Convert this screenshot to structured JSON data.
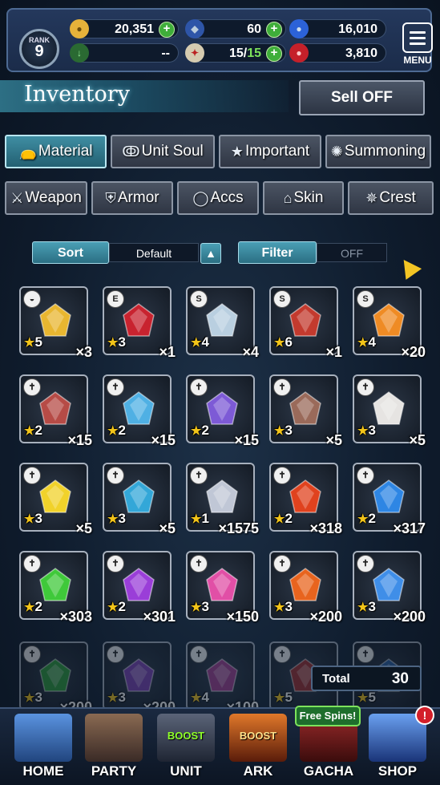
{
  "status": {
    "rank_label": "RANK",
    "rank": "9",
    "gil": "20,351",
    "visiore": "60",
    "lapis": "16,010",
    "exp_display": "--",
    "stamina": "15/",
    "stamina_max": "15",
    "ruby": "3,810",
    "menu_label": "MENU"
  },
  "header": {
    "title": "Inventory",
    "sell_label": "Sell OFF"
  },
  "tabs_row1": [
    {
      "label": "Material",
      "icon": "bag-icon",
      "active": true
    },
    {
      "label": "Unit Soul",
      "icon": "soul-icon",
      "active": false
    },
    {
      "label": "Important",
      "icon": "star-icon",
      "active": false
    },
    {
      "label": "Summoning",
      "icon": "summon-icon",
      "active": false
    }
  ],
  "tabs_row2": [
    {
      "label": "Weapon",
      "icon": "sword-icon"
    },
    {
      "label": "Armor",
      "icon": "armor-icon"
    },
    {
      "label": "Accs",
      "icon": "ring-icon"
    },
    {
      "label": "Skin",
      "icon": "hanger-icon"
    },
    {
      "label": "Crest",
      "icon": "crest-icon"
    }
  ],
  "controls": {
    "sort_label": "Sort",
    "sort_value": "Default",
    "filter_label": "Filter",
    "filter_value": "OFF"
  },
  "items": [
    {
      "stars": "5",
      "qty": "×3",
      "badge": "bag",
      "color": "#e8b630"
    },
    {
      "stars": "3",
      "qty": "×1",
      "badge": "EXP",
      "color": "#c8232f"
    },
    {
      "stars": "4",
      "qty": "×4",
      "badge": "ST",
      "color": "#b9cfe0"
    },
    {
      "stars": "6",
      "qty": "×1",
      "badge": "ST",
      "color": "#c33a2e"
    },
    {
      "stars": "4",
      "qty": "×20",
      "badge": "ST",
      "color": "#ef8b24"
    },
    {
      "stars": "2",
      "qty": "×15",
      "badge": "M",
      "color": "#b64b46"
    },
    {
      "stars": "2",
      "qty": "×15",
      "badge": "M",
      "color": "#4fb0e4"
    },
    {
      "stars": "2",
      "qty": "×15",
      "badge": "M",
      "color": "#7d5ad6"
    },
    {
      "stars": "3",
      "qty": "×5",
      "badge": "M",
      "color": "#9a6a5a"
    },
    {
      "stars": "3",
      "qty": "×5",
      "badge": "M",
      "color": "#e6e4e2"
    },
    {
      "stars": "3",
      "qty": "×5",
      "badge": "M",
      "color": "#f1d22a"
    },
    {
      "stars": "3",
      "qty": "×5",
      "badge": "M",
      "color": "#33a7d8"
    },
    {
      "stars": "1",
      "qty": "×1575",
      "badge": "M",
      "color": "#c0c7d6"
    },
    {
      "stars": "2",
      "qty": "×318",
      "badge": "M",
      "color": "#e0421e"
    },
    {
      "stars": "2",
      "qty": "×317",
      "badge": "M",
      "color": "#2e86e4"
    },
    {
      "stars": "2",
      "qty": "×303",
      "badge": "M",
      "color": "#3fc93a"
    },
    {
      "stars": "2",
      "qty": "×301",
      "badge": "M",
      "color": "#9a3ed8"
    },
    {
      "stars": "3",
      "qty": "×150",
      "badge": "M",
      "color": "#e14fa6"
    },
    {
      "stars": "3",
      "qty": "×200",
      "badge": "M",
      "color": "#e8641e"
    },
    {
      "stars": "3",
      "qty": "×200",
      "badge": "M",
      "color": "#3f8ee8"
    },
    {
      "stars": "3",
      "qty": "×200",
      "badge": "M",
      "color": "#2f9e3a"
    },
    {
      "stars": "3",
      "qty": "×200",
      "badge": "M",
      "color": "#7a3eb0"
    },
    {
      "stars": "4",
      "qty": "×100",
      "badge": "M",
      "color": "#a13a8a"
    },
    {
      "stars": "5",
      "qty": "",
      "badge": "M",
      "color": "#9e2b2b"
    },
    {
      "stars": "5",
      "qty": "",
      "badge": "M",
      "color": "#2b5fa0"
    }
  ],
  "total": {
    "label": "Total",
    "value": "30"
  },
  "nav": [
    {
      "label": "HOME",
      "color": "#3c76c7"
    },
    {
      "label": "PARTY",
      "color": "#6b4a3e"
    },
    {
      "label": "UNIT",
      "color": "#3b4458",
      "boost": "BOOST"
    },
    {
      "label": "ARK",
      "color": "#a2421a",
      "boost": "BOOST"
    },
    {
      "label": "GACHA",
      "color": "#6b1b1b"
    },
    {
      "label": "SHOP",
      "color": "#2a4aa0"
    }
  ],
  "free_spins": "Free Spins!",
  "alert": "!"
}
